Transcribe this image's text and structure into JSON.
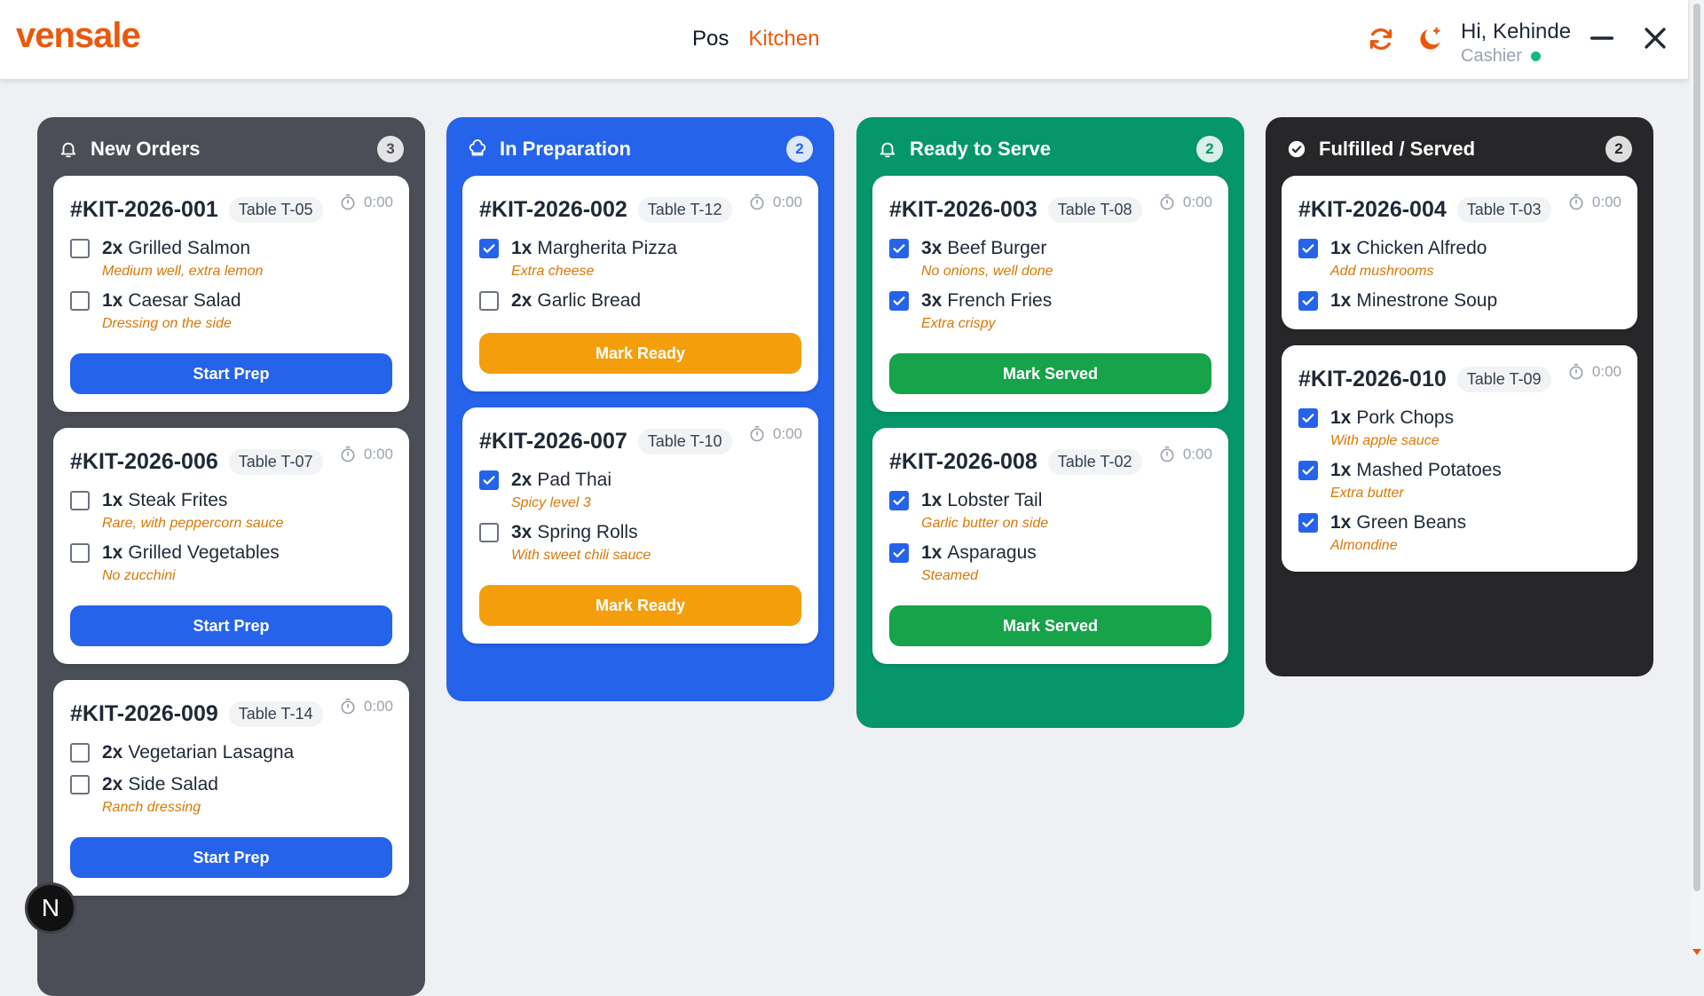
{
  "app": {
    "logo": "vensale"
  },
  "nav": {
    "pos": "Pos",
    "kitchen": "Kitchen"
  },
  "user": {
    "greeting": "Hi, Kehinde",
    "role": "Cashier"
  },
  "colors": {
    "brand": "#ea580c",
    "new": "#4b4e57",
    "prep": "#2563eb",
    "ready": "#059669",
    "served": "#27272a"
  },
  "columns": [
    {
      "title": "New Orders",
      "count": "3",
      "icon": "bell-icon",
      "orders": [
        {
          "id": "#KIT-2026-001",
          "table": "Table T-05",
          "timer": "0:00",
          "action": "Start Prep",
          "items": [
            {
              "qty": "2x",
              "name": "Grilled Salmon",
              "note": "Medium well, extra lemon",
              "checked": false
            },
            {
              "qty": "1x",
              "name": "Caesar Salad",
              "note": "Dressing on the side",
              "checked": false
            }
          ]
        },
        {
          "id": "#KIT-2026-006",
          "table": "Table T-07",
          "timer": "0:00",
          "action": "Start Prep",
          "items": [
            {
              "qty": "1x",
              "name": "Steak Frites",
              "note": "Rare, with peppercorn sauce",
              "checked": false
            },
            {
              "qty": "1x",
              "name": "Grilled Vegetables",
              "note": "No zucchini",
              "checked": false
            }
          ]
        },
        {
          "id": "#KIT-2026-009",
          "table": "Table T-14",
          "timer": "0:00",
          "action": "Start Prep",
          "items": [
            {
              "qty": "2x",
              "name": "Vegetarian Lasagna",
              "note": "",
              "checked": false
            },
            {
              "qty": "2x",
              "name": "Side Salad",
              "note": "Ranch dressing",
              "checked": false
            }
          ]
        }
      ]
    },
    {
      "title": "In Preparation",
      "count": "2",
      "icon": "chef-hat-icon",
      "orders": [
        {
          "id": "#KIT-2026-002",
          "table": "Table T-12",
          "timer": "0:00",
          "action": "Mark Ready",
          "items": [
            {
              "qty": "1x",
              "name": "Margherita Pizza",
              "note": "Extra cheese",
              "checked": true
            },
            {
              "qty": "2x",
              "name": "Garlic Bread",
              "note": "",
              "checked": false
            }
          ]
        },
        {
          "id": "#KIT-2026-007",
          "table": "Table T-10",
          "timer": "0:00",
          "action": "Mark Ready",
          "items": [
            {
              "qty": "2x",
              "name": "Pad Thai",
              "note": "Spicy level 3",
              "checked": true
            },
            {
              "qty": "3x",
              "name": "Spring Rolls",
              "note": "With sweet chili sauce",
              "checked": false
            }
          ]
        }
      ]
    },
    {
      "title": "Ready to Serve",
      "count": "2",
      "icon": "bell-icon",
      "orders": [
        {
          "id": "#KIT-2026-003",
          "table": "Table T-08",
          "timer": "0:00",
          "action": "Mark Served",
          "items": [
            {
              "qty": "3x",
              "name": "Beef Burger",
              "note": "No onions, well done",
              "checked": true
            },
            {
              "qty": "3x",
              "name": "French Fries",
              "note": "Extra crispy",
              "checked": true
            }
          ]
        },
        {
          "id": "#KIT-2026-008",
          "table": "Table T-02",
          "timer": "0:00",
          "action": "Mark Served",
          "items": [
            {
              "qty": "1x",
              "name": "Lobster Tail",
              "note": "Garlic butter on side",
              "checked": true
            },
            {
              "qty": "1x",
              "name": "Asparagus",
              "note": "Steamed",
              "checked": true
            }
          ]
        }
      ]
    },
    {
      "title": "Fulfilled / Served",
      "count": "2",
      "icon": "check-circle-icon",
      "orders": [
        {
          "id": "#KIT-2026-004",
          "table": "Table T-03",
          "timer": "0:00",
          "action": "",
          "items": [
            {
              "qty": "1x",
              "name": "Chicken Alfredo",
              "note": "Add mushrooms",
              "checked": true
            },
            {
              "qty": "1x",
              "name": "Minestrone Soup",
              "note": "",
              "checked": true
            }
          ]
        },
        {
          "id": "#KIT-2026-010",
          "table": "Table T-09",
          "timer": "0:00",
          "action": "",
          "items": [
            {
              "qty": "1x",
              "name": "Pork Chops",
              "note": "With apple sauce",
              "checked": true
            },
            {
              "qty": "1x",
              "name": "Mashed Potatoes",
              "note": "Extra butter",
              "checked": true
            },
            {
              "qty": "1x",
              "name": "Green Beans",
              "note": "Almondine",
              "checked": true
            }
          ]
        }
      ]
    }
  ],
  "dev_badge": "N"
}
